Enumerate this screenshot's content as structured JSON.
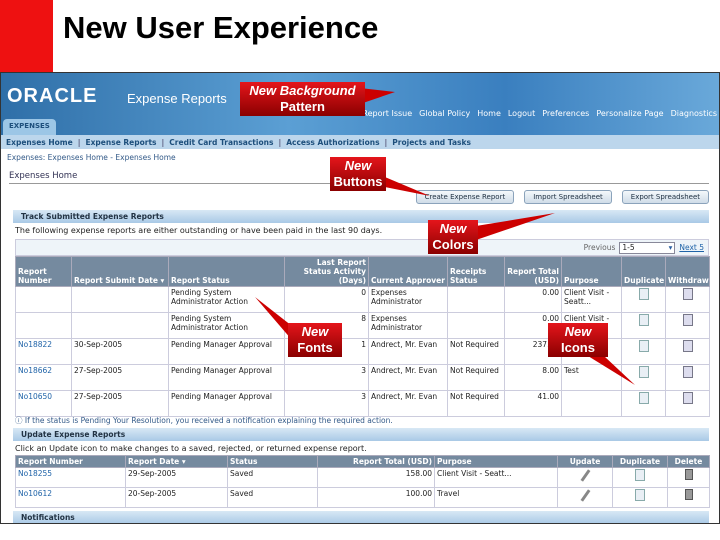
{
  "slide": {
    "title": "New User Experience"
  },
  "header": {
    "logo": "ORACLE",
    "app_name": "Expense Reports",
    "global_links": [
      "Report Issue",
      "Global Policy",
      "Home",
      "Logout",
      "Preferences",
      "Personalize Page",
      "Diagnostics"
    ],
    "tab": "EXPENSES"
  },
  "nav": [
    "Expenses Home",
    "Expense Reports",
    "Credit Card Transactions",
    "Access Authorizations",
    "Projects and Tasks"
  ],
  "breadcrumb": "Expenses: Expenses Home  -  Expenses Home",
  "page_title": "Expenses Home",
  "buttons": [
    "Create Expense Report",
    "Import Spreadsheet",
    "Export Spreadsheet"
  ],
  "track": {
    "title": "Track Submitted Expense Reports",
    "description": "The following expense reports are either outstanding or have been paid in the last 90 days.",
    "previous": "Previous",
    "range": "1-5",
    "next": "Next 5",
    "columns": [
      "Report Number",
      "Report Submit Date ▾",
      "Report Status",
      "Last Report Status Activity (Days)",
      "Current Approver",
      "Receipts Status",
      "Report Total (USD)",
      "Purpose",
      "Duplicate",
      "Withdraw"
    ],
    "rows": [
      [
        "",
        "",
        "Pending System Administrator Action",
        "0",
        "Expenses Administrator",
        "",
        "0.00",
        "Client Visit - Seatt..."
      ],
      [
        "",
        "",
        "Pending System Administrator Action",
        "8",
        "Expenses Administrator",
        "",
        "0.00",
        "Client Visit - Seatt..."
      ],
      [
        "No18822",
        "30-Sep-2005",
        "Pending Manager Approval",
        "1",
        "Andrect, Mr. Evan",
        "Not Required",
        "237.80",
        ""
      ],
      [
        "No18662",
        "27-Sep-2005",
        "Pending Manager Approval",
        "3",
        "Andrect, Mr. Evan",
        "Not Required",
        "8.00",
        "Test"
      ],
      [
        "No10650",
        "27-Sep-2005",
        "Pending Manager Approval",
        "3",
        "Andrect, Mr. Evan",
        "Not Required",
        "41.00",
        ""
      ]
    ],
    "footnote": "If the status is Pending Your Resolution, you received a notification explaining the required action."
  },
  "update": {
    "title": "Update Expense Reports",
    "description": "Click an Update icon to make changes to a saved, rejected, or returned expense report.",
    "columns": [
      "Report Number",
      "Report Date ▾",
      "Status",
      "Report Total (USD)",
      "Purpose",
      "Update",
      "Duplicate",
      "Delete"
    ],
    "rows": [
      [
        "No18255",
        "29-Sep-2005",
        "Saved",
        "158.00",
        "Client Visit - Seatt..."
      ],
      [
        "No10612",
        "20-Sep-2005",
        "Saved",
        "100.00",
        "Travel"
      ]
    ]
  },
  "notifications": {
    "title": "Notifications"
  },
  "callouts": {
    "background": [
      "New Background",
      "Pattern"
    ],
    "buttons": [
      "New",
      "Buttons"
    ],
    "colors": [
      "New",
      "Colors"
    ],
    "fonts": [
      "New",
      "Fonts"
    ],
    "icons": [
      "New",
      "Icons"
    ]
  },
  "colors": {
    "accent_red": "#e4151b",
    "header_blue": "#3a7fbf",
    "table_header": "#758a9f"
  }
}
